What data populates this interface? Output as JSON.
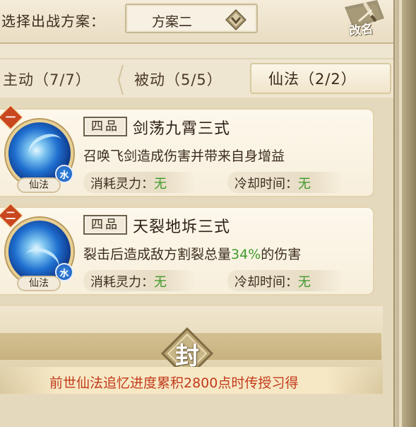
{
  "header": {
    "plan_label": "选择出战方案：",
    "plan_value": "方案二",
    "rename_label": "改名"
  },
  "tabs": [
    {
      "label": "主动（7/7）",
      "active": false
    },
    {
      "label": "被动（5/5）",
      "active": false
    },
    {
      "label": "仙法（2/2）",
      "active": true
    }
  ],
  "skills": [
    {
      "slot": "一",
      "grade": "四品",
      "name": "剑荡九霄三式",
      "desc_pre": "召唤飞剑造成伤害并带来自身增益",
      "desc_highlight": "",
      "desc_post": "",
      "element": "水",
      "type": "仙法",
      "cost_label": "消耗灵力：",
      "cost_value": "无",
      "cooldown_label": "冷却时间：",
      "cooldown_value": "无"
    },
    {
      "slot": "二",
      "grade": "四品",
      "name": "天裂地坼三式",
      "desc_pre": "裂击后造成敌方割裂总量",
      "desc_highlight": "34%",
      "desc_post": "的伤害",
      "element": "水",
      "type": "仙法",
      "cost_label": "消耗灵力：",
      "cost_value": "无",
      "cooldown_label": "冷却时间：",
      "cooldown_value": "无"
    }
  ],
  "locked_slot": {
    "seal_char": "封",
    "unlock_text": "前世仙法追忆进度累积2800点时传授习得"
  },
  "colors": {
    "highlight_green": "#3e9a2c",
    "unlock_red": "#c23a1b",
    "slot_badge": "#c9471f",
    "water_element": "#1a58b8"
  }
}
